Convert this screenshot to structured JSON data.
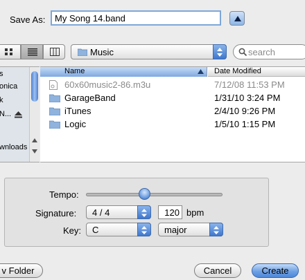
{
  "save_as": {
    "label": "Save As:",
    "filename": "My Song 14.band"
  },
  "toolbar": {
    "location": "Music",
    "search_placeholder": "search"
  },
  "sidebar": {
    "items": [
      "s",
      "onica",
      "k",
      "N...",
      "",
      "",
      "wnloads",
      ""
    ]
  },
  "file_list": {
    "columns": {
      "name": "Name",
      "date": "Date Modified"
    },
    "rows": [
      {
        "name": "60x60music2-86.m3u",
        "date": "7/12/08 11:53 PM",
        "icon": "document-icon",
        "enabled": false
      },
      {
        "name": "GarageBand",
        "date": "1/31/10 3:24 PM",
        "icon": "folder-icon",
        "enabled": true
      },
      {
        "name": "iTunes",
        "date": "2/4/10 9:26 PM",
        "icon": "folder-icon",
        "enabled": true
      },
      {
        "name": "Logic",
        "date": "1/5/10 1:15 PM",
        "icon": "folder-icon",
        "enabled": true
      }
    ]
  },
  "options": {
    "tempo_label": "Tempo:",
    "tempo_level": 0.42,
    "signature_label": "Signature:",
    "signature_value": "4 / 4",
    "bpm_value": "120",
    "bpm_unit": "bpm",
    "key_label": "Key:",
    "key_value": "C",
    "mode_value": "major"
  },
  "buttons": {
    "new_folder": "v Folder",
    "cancel": "Cancel",
    "create": "Create"
  },
  "colors": {
    "accent": "#4d87d9",
    "selection_header": "#7fa9e0",
    "background": "#ececec"
  }
}
